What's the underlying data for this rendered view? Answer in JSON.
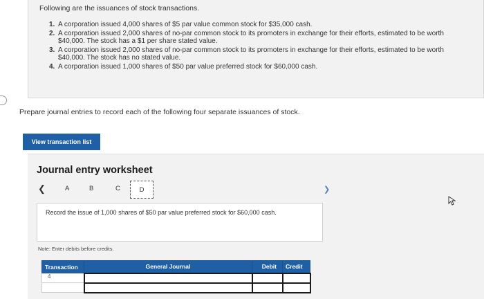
{
  "question": {
    "intro": "Following are the issuances of stock transactions.",
    "items": [
      {
        "num": "1.",
        "text": "A corporation issued 4,000 shares of $5 par value common stock for $35,000 cash."
      },
      {
        "num": "2.",
        "text": "A corporation issued 2,000 shares of no-par common stock to its promoters in exchange for their efforts, estimated to be worth $40,000. The stock has a $1 per share stated value."
      },
      {
        "num": "3.",
        "text": "A corporation issued 2,000 shares of no-par common stock to its promoters in exchange for their efforts, estimated to be worth $40,000. The stock has no stated value."
      },
      {
        "num": "4.",
        "text": "A corporation issued 1,000 shares of $50 par value preferred stock for $60,000 cash."
      }
    ]
  },
  "instruction": "Prepare journal entries to record each of the following four separate issuances of stock.",
  "view_button_label": "View transaction list",
  "worksheet": {
    "title": "Journal entry worksheet",
    "tabs": [
      "A",
      "B",
      "C",
      "D"
    ],
    "active_tab": "D",
    "description": "Record the issue of 1,000 shares of $50 par value preferred stock for $60,000 cash.",
    "note": "Note: Enter debits before credits.",
    "table": {
      "headers": {
        "transaction": "Transaction",
        "account": "General Journal",
        "debit": "Debit",
        "credit": "Credit"
      },
      "rows": [
        {
          "transaction": "4",
          "account": "",
          "debit": "",
          "credit": ""
        },
        {
          "transaction": "",
          "account": "",
          "debit": "",
          "credit": ""
        }
      ]
    }
  },
  "nav": {
    "prev_icon": "chevron-left-icon",
    "next_icon": "chevron-right-icon"
  },
  "colors": {
    "accent": "#1f5fa6",
    "panel": "#f2f2f2"
  }
}
